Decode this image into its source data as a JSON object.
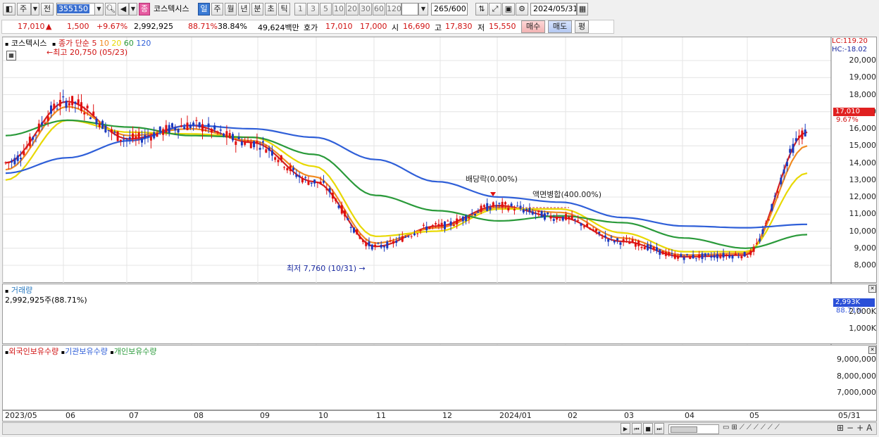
{
  "toolbar": {
    "market_select": "주",
    "period_label": "전",
    "code": "355150",
    "name_badge": "종",
    "name": "코스텍시스",
    "period_buttons": [
      "일",
      "주",
      "월",
      "년",
      "분",
      "초",
      "틱"
    ],
    "minute_buttons": [
      "1",
      "3",
      "5",
      "10",
      "20",
      "30",
      "60",
      "120"
    ],
    "count": "265",
    "count_total": "/600",
    "date": "2024/05/31"
  },
  "quote": {
    "price": "17,010",
    "arrow": "▲",
    "change": "1,500",
    "change_pct": "+9.67%",
    "volume": "2,992,925",
    "volume_pct": "88.71%",
    "turnover": "38.84%",
    "amount": "49,624백만",
    "bid_label": "호가",
    "bid1": "17,010",
    "bid2": "17,000",
    "open_label": "시",
    "open": "16,690",
    "high_label": "고",
    "high": "17,830",
    "low_label": "저",
    "low": "15,550",
    "buy_button": "매수",
    "sell_button": "매도",
    "eval_button": "평"
  },
  "price_chart": {
    "title": "코스텍시스",
    "indicator_label": "종가 단순",
    "ma": [
      {
        "name": "5",
        "color": "#d42020"
      },
      {
        "name": "10",
        "color": "#f08a20"
      },
      {
        "name": "20",
        "color": "#e8d800"
      },
      {
        "name": "60",
        "color": "#2a9a3a"
      },
      {
        "name": "120",
        "color": "#2f5fd8"
      }
    ],
    "high_note": "최고 20,750 (05/23)",
    "low_note": "최저 7,760 (10/31)",
    "dividend_note": "배당락(0.00%)",
    "split_note": "액면병합(400.00%)",
    "lc": "LC:119.20",
    "hc": "HC:-18.02",
    "last_price": "17,010",
    "last_pct": "9.67%",
    "y_labels": [
      "20,000",
      "19,000",
      "18,000",
      "17,000",
      "16,000",
      "15,000",
      "14,000",
      "13,000",
      "12,000",
      "11,000",
      "10,000",
      "9,000",
      "8,000"
    ]
  },
  "volume_chart": {
    "title": "거래량",
    "value_note": "2,992,925주(88.71%)",
    "last_value": "2,993K",
    "last_pct": "88.71%",
    "y_labels": [
      "2,000K",
      "1,000K"
    ]
  },
  "holdings_chart": {
    "legend": [
      {
        "name": "외국인보유수량",
        "color": "#d01010"
      },
      {
        "name": "기관보유수량",
        "color": "#2f5fd8"
      },
      {
        "name": "개인보유수량",
        "color": "#2a9a3a"
      }
    ],
    "y_labels": [
      "9,000,000",
      "8,000,000",
      "7,000,000"
    ]
  },
  "x_axis": {
    "labels": [
      "2023/05",
      "06",
      "07",
      "08",
      "09",
      "10",
      "11",
      "12",
      "2024/01",
      "02",
      "03",
      "04",
      "05"
    ],
    "last": "05/31"
  },
  "chart_data": {
    "type": "line",
    "title": "코스텍시스",
    "x": [
      "2023/05",
      "06",
      "07",
      "08",
      "09",
      "10",
      "11",
      "12",
      "2024/01",
      "02",
      "03",
      "04",
      "05",
      "05/31"
    ],
    "series": [
      {
        "name": "5",
        "values": [
          14000,
          17600,
          15400,
          16200,
          15200,
          12900,
          9100,
          10300,
          11500,
          10800,
          9400,
          8500,
          8600,
          15800
        ]
      },
      {
        "name": "10",
        "values": [
          13600,
          17300,
          15600,
          16000,
          15300,
          13200,
          9300,
          10200,
          11400,
          11100,
          9600,
          8600,
          8700,
          15000
        ]
      },
      {
        "name": "20",
        "values": [
          13000,
          16500,
          15800,
          15700,
          15500,
          13800,
          9700,
          10000,
          11300,
          11300,
          9900,
          8800,
          8800,
          13400
        ]
      },
      {
        "name": "60",
        "values": [
          15600,
          16500,
          16100,
          15600,
          15500,
          14500,
          12100,
          11200,
          10600,
          10900,
          10500,
          9600,
          9000,
          9800
        ]
      },
      {
        "name": "120",
        "values": [
          13400,
          14300,
          15300,
          16200,
          16000,
          15500,
          14200,
          12900,
          12000,
          11700,
          10800,
          10300,
          10200,
          10400
        ]
      }
    ],
    "ylim": [
      7500,
      20800
    ]
  }
}
